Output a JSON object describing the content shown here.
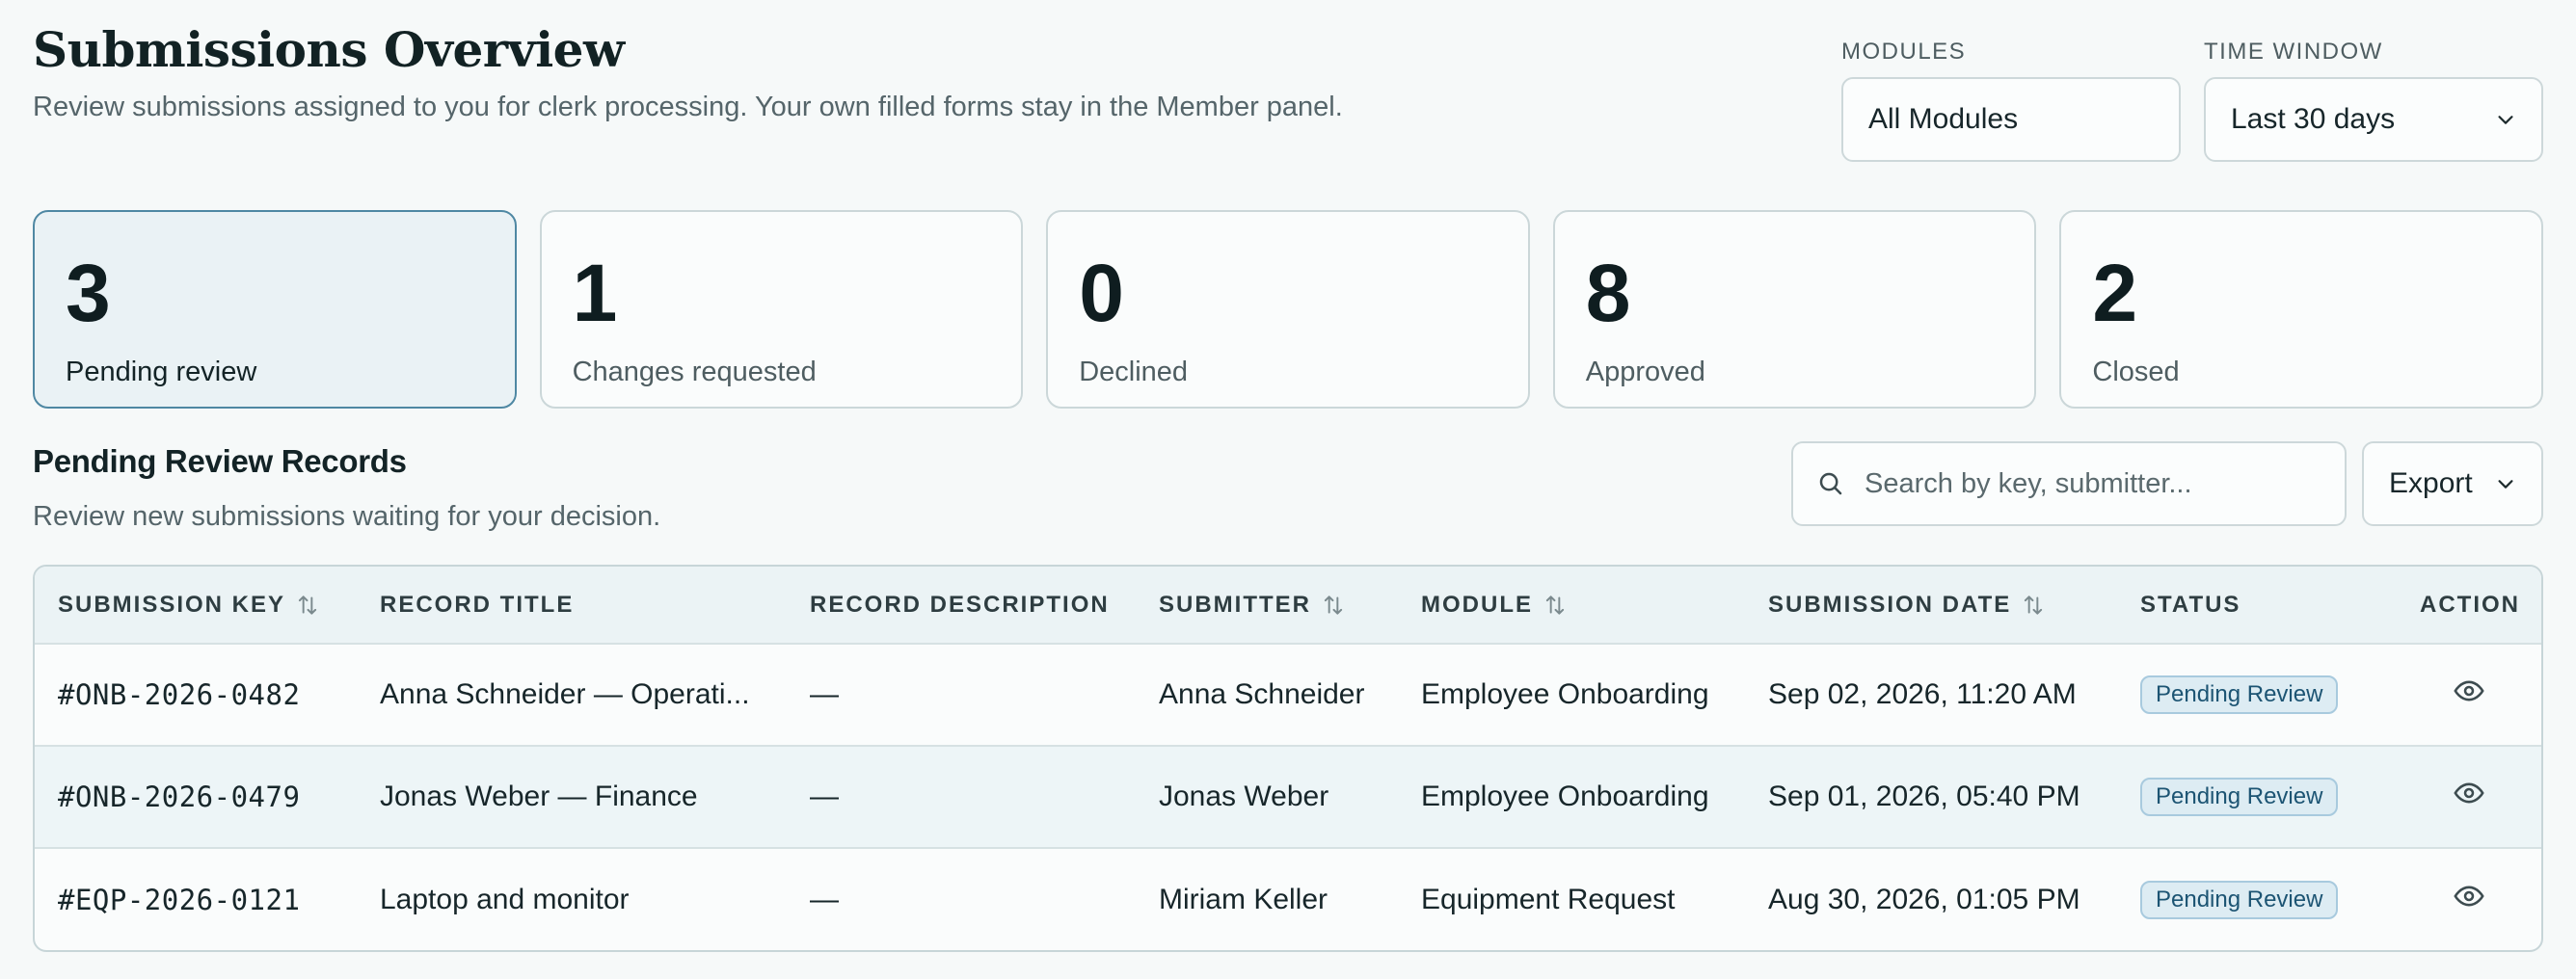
{
  "header": {
    "title": "Submissions Overview",
    "subtitle": "Review submissions assigned to you for clerk processing. Your own filled forms stay in the Member panel."
  },
  "filters": {
    "modules": {
      "label": "MODULES",
      "value": "All Modules"
    },
    "time_window": {
      "label": "TIME WINDOW",
      "value": "Last 30 days"
    }
  },
  "stats": [
    {
      "value": "3",
      "label": "Pending review",
      "active": true
    },
    {
      "value": "1",
      "label": "Changes requested"
    },
    {
      "value": "0",
      "label": "Declined"
    },
    {
      "value": "8",
      "label": "Approved"
    },
    {
      "value": "2",
      "label": "Closed"
    }
  ],
  "section": {
    "title": "Pending Review Records",
    "subtitle": "Review new submissions waiting for your decision."
  },
  "search": {
    "placeholder": "Search by key, submitter..."
  },
  "export": {
    "label": "Export"
  },
  "table": {
    "columns": {
      "key": "SUBMISSION KEY",
      "title": "RECORD TITLE",
      "description": "RECORD DESCRIPTION",
      "submitter": "SUBMITTER",
      "module": "MODULE",
      "date": "SUBMISSION DATE",
      "status": "STATUS",
      "action": "ACTION"
    },
    "rows": [
      {
        "key": "#ONB-2026-0482",
        "title": "Anna Schneider — Operati...",
        "description": "—",
        "submitter": "Anna Schneider",
        "module": "Employee Onboarding",
        "date": "Sep 02, 2026, 11:20 AM",
        "status": "Pending Review"
      },
      {
        "key": "#ONB-2026-0479",
        "title": "Jonas Weber — Finance",
        "description": "—",
        "submitter": "Jonas Weber",
        "module": "Employee Onboarding",
        "date": "Sep 01, 2026, 05:40 PM",
        "status": "Pending Review"
      },
      {
        "key": "#EQP-2026-0121",
        "title": "Laptop and monitor",
        "description": "—",
        "submitter": "Miriam Keller",
        "module": "Equipment Request",
        "date": "Aug 30, 2026, 01:05 PM",
        "status": "Pending Review"
      }
    ]
  },
  "colors": {
    "accent": "#4f88a3",
    "badge_bg": "#ddecf3",
    "badge_text": "#1c5473"
  }
}
